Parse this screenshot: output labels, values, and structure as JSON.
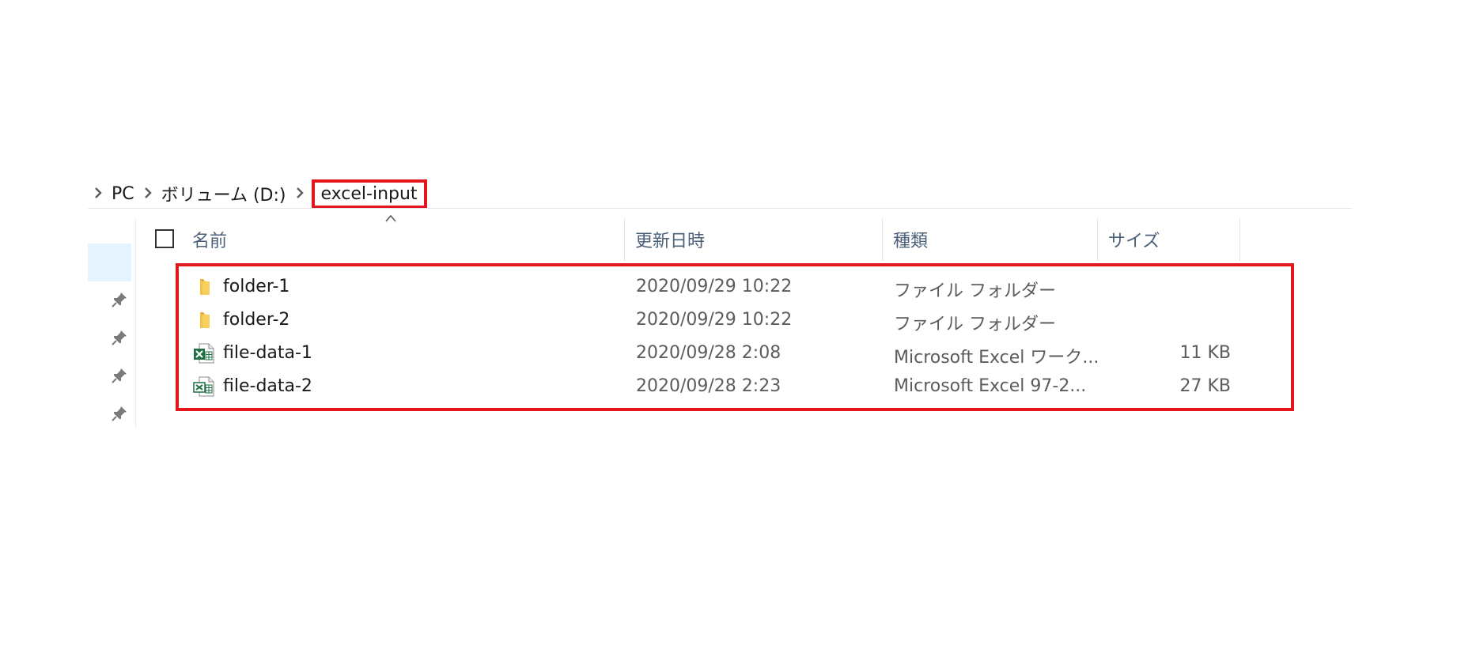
{
  "breadcrumb": {
    "items": [
      "PC",
      "ボリューム (D:)",
      "excel-input"
    ]
  },
  "columns": {
    "name": "名前",
    "modified": "更新日時",
    "type": "種類",
    "size": "サイズ"
  },
  "files": [
    {
      "name": "folder-1",
      "modified": "2020/09/29 10:22",
      "type": "ファイル フォルダー",
      "size": "",
      "icon": "folder-icon"
    },
    {
      "name": "folder-2",
      "modified": "2020/09/29 10:22",
      "type": "ファイル フォルダー",
      "size": "",
      "icon": "folder-icon"
    },
    {
      "name": "file-data-1",
      "modified": "2020/09/28 2:08",
      "type": "Microsoft Excel ワーク...",
      "size": "11 KB",
      "icon": "excel-xlsx-icon"
    },
    {
      "name": "file-data-2",
      "modified": "2020/09/28 2:23",
      "type": "Microsoft Excel 97-2...",
      "size": "27 KB",
      "icon": "excel-xls-icon"
    }
  ],
  "colors": {
    "highlight": "#e3161e",
    "header_text": "#4c607a",
    "nav_selected": "#e5f3ff",
    "folder": "#f5c244",
    "excel": "#1d7044"
  }
}
